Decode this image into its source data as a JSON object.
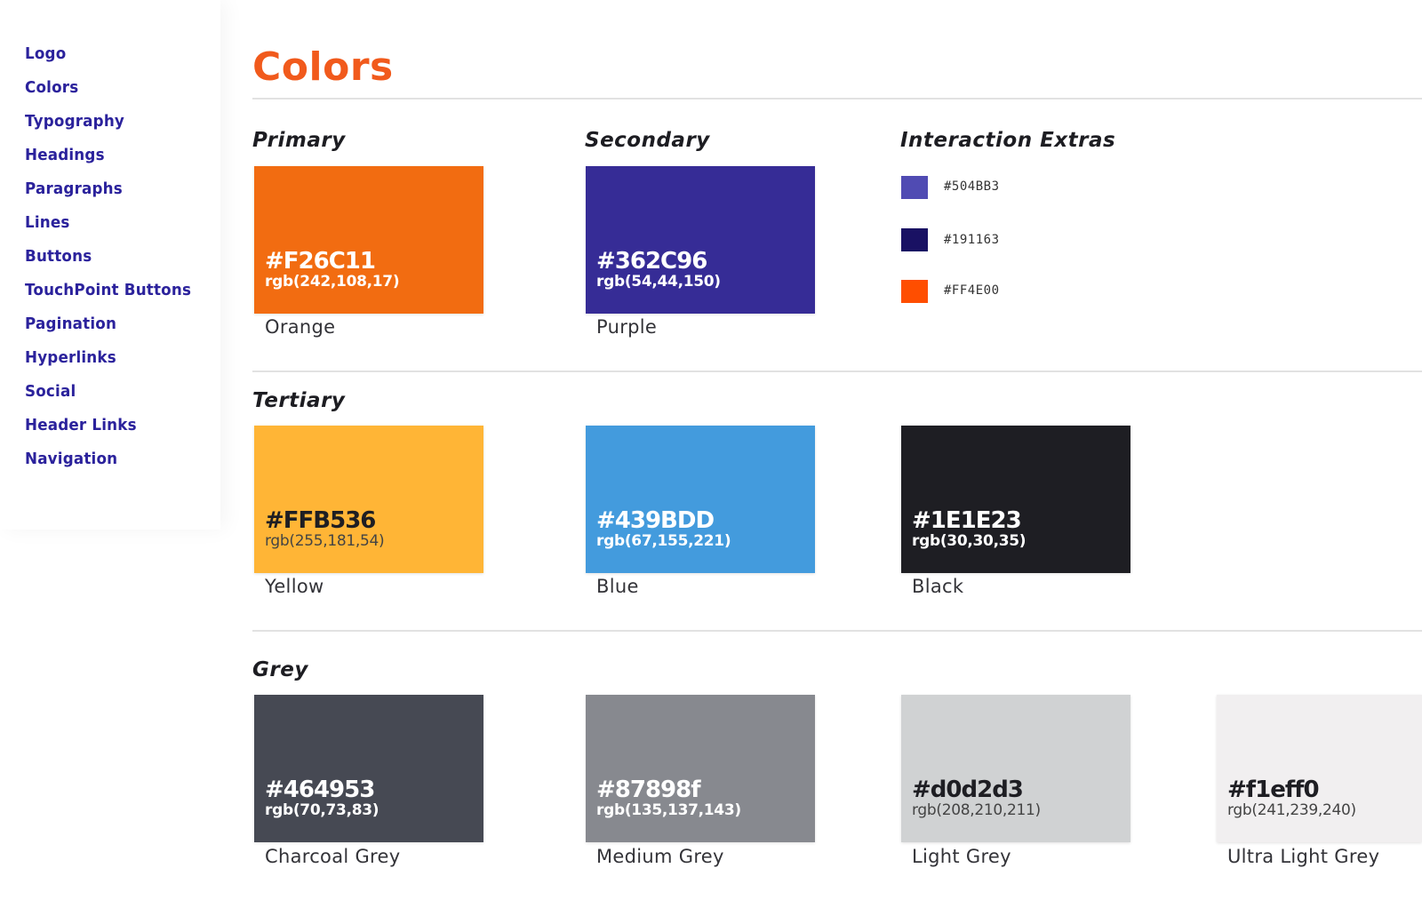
{
  "sidebar": {
    "items": [
      {
        "label": "Logo"
      },
      {
        "label": "Colors"
      },
      {
        "label": "Typography"
      },
      {
        "label": "Headings"
      },
      {
        "label": "Paragraphs"
      },
      {
        "label": "Lines"
      },
      {
        "label": "Buttons"
      },
      {
        "label": "TouchPoint Buttons"
      },
      {
        "label": "Pagination"
      },
      {
        "label": "Hyperlinks"
      },
      {
        "label": "Social"
      },
      {
        "label": "Header Links"
      },
      {
        "label": "Navigation"
      }
    ]
  },
  "main": {
    "title": "Colors",
    "sections": {
      "primary": {
        "heading": "Primary"
      },
      "secondary": {
        "heading": "Secondary"
      },
      "interaction": {
        "heading": "Interaction Extras"
      },
      "tertiary": {
        "heading": "Tertiary"
      },
      "grey": {
        "heading": "Grey"
      }
    },
    "swatches": {
      "orange": {
        "hex": "#F26C11",
        "rgb": "rgb(242,108,17)",
        "name": "Orange",
        "color": "#F26C11"
      },
      "purple": {
        "hex": "#362C96",
        "rgb": "rgb(54,44,150)",
        "name": "Purple",
        "color": "#362C96"
      },
      "yellow": {
        "hex": "#FFB536",
        "rgb": "rgb(255,181,54)",
        "name": "Yellow",
        "color": "#FFB536"
      },
      "blue": {
        "hex": "#439BDD",
        "rgb": "rgb(67,155,221)",
        "name": "Blue",
        "color": "#439BDD"
      },
      "black": {
        "hex": "#1E1E23",
        "rgb": "rgb(30,30,35)",
        "name": "Black",
        "color": "#1E1E23"
      },
      "charcoal": {
        "hex": "#464953",
        "rgb": "rgb(70,73,83)",
        "name": "Charcoal Grey",
        "color": "#464953"
      },
      "medium": {
        "hex": "#87898f",
        "rgb": "rgb(135,137,143)",
        "name": "Medium Grey",
        "color": "#87898f"
      },
      "light": {
        "hex": "#d0d2d3",
        "rgb": "rgb(208,210,211)",
        "name": "Light Grey",
        "color": "#d0d2d3"
      },
      "ultralight": {
        "hex": "#f1eff0",
        "rgb": "rgb(241,239,240)",
        "name": "Ultra Light Grey",
        "color": "#f1eff0"
      }
    },
    "interaction_extras": [
      {
        "label": "#504BB3",
        "color": "#504BB3"
      },
      {
        "label": "#191163",
        "color": "#191163"
      },
      {
        "label": "#FF4E00",
        "color": "#FF4E00"
      }
    ]
  }
}
